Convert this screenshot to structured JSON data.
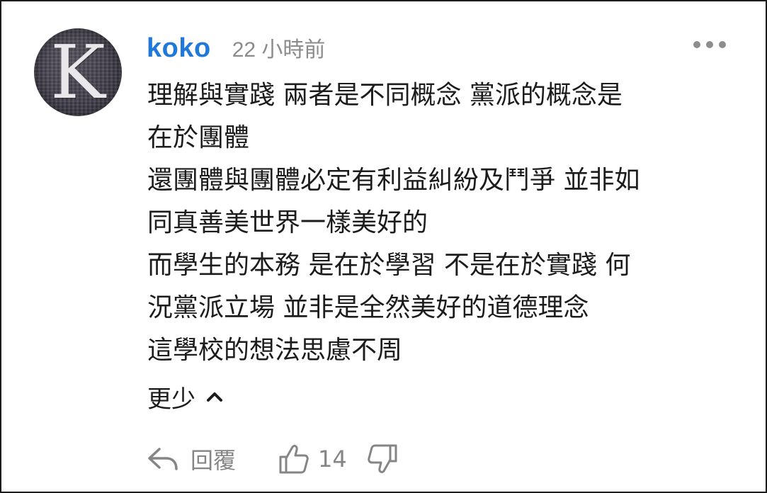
{
  "comment": {
    "avatar_letter": "K",
    "username": "koko",
    "timestamp": "22 小時前",
    "body_lines": [
      "理解與實踐 兩者是不同概念 黨派的概念是",
      "在於團體",
      "還團體與團體必定有利益糾紛及鬥爭 並非如",
      "同真善美世界一樣美好的",
      "而學生的本務 是在於學習 不是在於實踐 何",
      "況黨派立場 並非是全然美好的道德理念",
      "這學校的想法思慮不周"
    ],
    "show_less_label": "更少",
    "actions": {
      "reply_label": "回覆",
      "like_count": "14"
    },
    "icons": {
      "more": "more-horizontal-icon",
      "chevron": "chevron-up-icon",
      "reply": "reply-icon",
      "like": "thumbs-up-icon",
      "dislike": "thumbs-down-icon"
    },
    "colors": {
      "username": "#1f79d9",
      "muted": "#858585",
      "text": "#1c1c1c"
    }
  }
}
